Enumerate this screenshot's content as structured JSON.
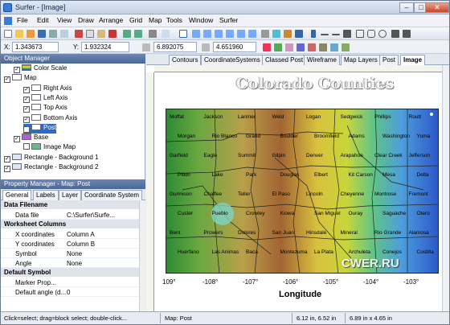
{
  "window": {
    "title": "Surfer - [Image]"
  },
  "menu": [
    "File",
    "Edit",
    "View",
    "Draw",
    "Arrange",
    "Grid",
    "Map",
    "Tools",
    "Window",
    "Surfer"
  ],
  "coords": {
    "x_label": "X:",
    "x_value": "1.343673",
    "y_label": "Y:",
    "y_value": "1.932324",
    "w_value": "6.892075",
    "h_value": "4.651960"
  },
  "object_manager": {
    "title": "Object Manager",
    "items": [
      {
        "label": "Color Scale",
        "indent": 1,
        "checked": true,
        "icon": "color-scale"
      },
      {
        "label": "Map",
        "indent": 0,
        "checked": true,
        "icon": "map"
      },
      {
        "label": "Right Axis",
        "indent": 2,
        "checked": true,
        "icon": "axis"
      },
      {
        "label": "Left Axis",
        "indent": 2,
        "checked": true,
        "icon": "axis"
      },
      {
        "label": "Top Axis",
        "indent": 2,
        "checked": true,
        "icon": "axis"
      },
      {
        "label": "Bottom Axis",
        "indent": 2,
        "checked": true,
        "icon": "axis"
      },
      {
        "label": "Post",
        "indent": 2,
        "checked": true,
        "icon": "post",
        "selected": true
      },
      {
        "label": "Base",
        "indent": 1,
        "checked": true,
        "icon": "base"
      },
      {
        "label": "Image Map",
        "indent": 2,
        "checked": false,
        "icon": "image-map"
      },
      {
        "label": "Rectangle - Background 1",
        "indent": 0,
        "checked": true,
        "icon": "rect"
      },
      {
        "label": "Rectangle - Background 2",
        "indent": 0,
        "checked": true,
        "icon": "rect"
      }
    ]
  },
  "property_manager": {
    "title": "Property Manager - Map: Post",
    "tabs": [
      "General",
      "Labels",
      "Layer",
      "Coordinate System"
    ],
    "sections": [
      {
        "title": "Data Filename",
        "rows": [
          {
            "name": "Data file",
            "value": "C:\\Surfer\\Surfe..."
          }
        ]
      },
      {
        "title": "Worksheet Columns",
        "rows": [
          {
            "name": "X coordinates",
            "value": "Column A"
          },
          {
            "name": "Y coordinates",
            "value": "Column B"
          },
          {
            "name": "Symbol",
            "value": "None"
          },
          {
            "name": "Angle",
            "value": "None"
          }
        ]
      },
      {
        "title": "Default Symbol",
        "rows": [
          {
            "name": "Marker Prop...",
            "value": ""
          },
          {
            "name": "Default angle (d...",
            "value": "0"
          }
        ]
      }
    ]
  },
  "doc_tabs": [
    "Contours",
    "CoordinateSystems",
    "Classed Post",
    "Wireframe",
    "Map Layers",
    "Post",
    "Image"
  ],
  "active_doc_tab": "Image",
  "map": {
    "title": "Colorado Counties",
    "xlabel": "Longitude",
    "lon_ticks": [
      "109°",
      "-108°",
      "-107°",
      "-106°",
      "-105°",
      "-104°",
      "-103°"
    ],
    "watermark": "CWER.RU",
    "counties": [
      "Moffat",
      "Jackson",
      "Larimer",
      "Weld",
      "Logan",
      "Sedgwick",
      "Phillips",
      "Routt",
      "Morgan",
      "Rio Blanco",
      "Grand",
      "Boulder",
      "Broomfield",
      "Adams",
      "Washington",
      "Yuma",
      "Garfield",
      "Eagle",
      "Summit",
      "Gilpin",
      "Denver",
      "Arapahoe",
      "Clear Creek",
      "Jefferson",
      "Pitkin",
      "Lake",
      "Park",
      "Douglas",
      "Elbert",
      "Kit Carson",
      "Mesa",
      "Delta",
      "Gunnison",
      "Chaffee",
      "Teller",
      "El Paso",
      "Lincoln",
      "Cheyenne",
      "Montrose",
      "Fremont",
      "Custer",
      "Pueblo",
      "Crowley",
      "Kiowa",
      "San Miguel",
      "Ouray",
      "Saguache",
      "Otero",
      "Bent",
      "Prowers",
      "Dolores",
      "San Juan",
      "Hinsdale",
      "Mineral",
      "Rio Grande",
      "Alamosa",
      "Huerfano",
      "Las Animas",
      "Baca",
      "Montezuma",
      "La Plata",
      "Archuleta",
      "Conejos",
      "Costilla"
    ]
  },
  "status": {
    "left": "Click=select; drag=block select; double-click...",
    "middle": "Map: Post",
    "pos": "6.12 in, 6.52 in",
    "size": "6.89 in x 4.65 in"
  }
}
